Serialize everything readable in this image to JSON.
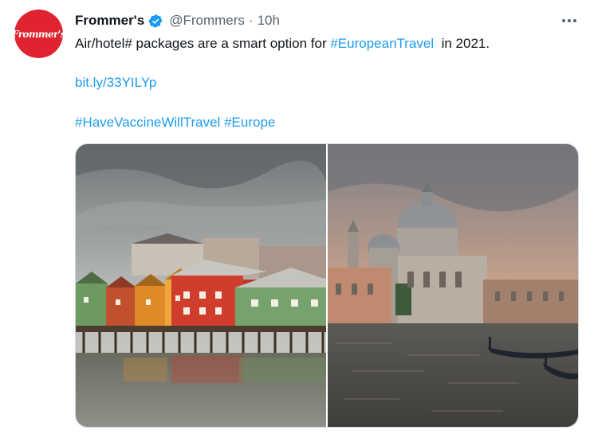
{
  "tweet": {
    "avatar_text": "Frommer's",
    "author_name": "Frommer's",
    "verified_icon": "verified-badge-icon",
    "handle": "@Frommers",
    "separator": "·",
    "time": "10h",
    "more_icon": "more-options-icon",
    "text_prefix": "Air/hotel# packages are a smart option for ",
    "hashtag_1": "#EuropeanTravel",
    "text_suffix": "  in 2021.",
    "short_link": "bit.ly/33YILYp",
    "hashtag_2": "#HaveVaccineWillTravel",
    "hashtag_3": "#Europe",
    "images": [
      {
        "subject": "colorful wooden waterfront warehouses on stilts",
        "icon": "photo-trondheim"
      },
      {
        "subject": "domed basilica on a canal with gondolas at sunset",
        "icon": "photo-venice"
      }
    ],
    "colors": {
      "link": "#1d9bf0",
      "brand_red": "#e0242f",
      "secondary_text": "#536471"
    }
  }
}
